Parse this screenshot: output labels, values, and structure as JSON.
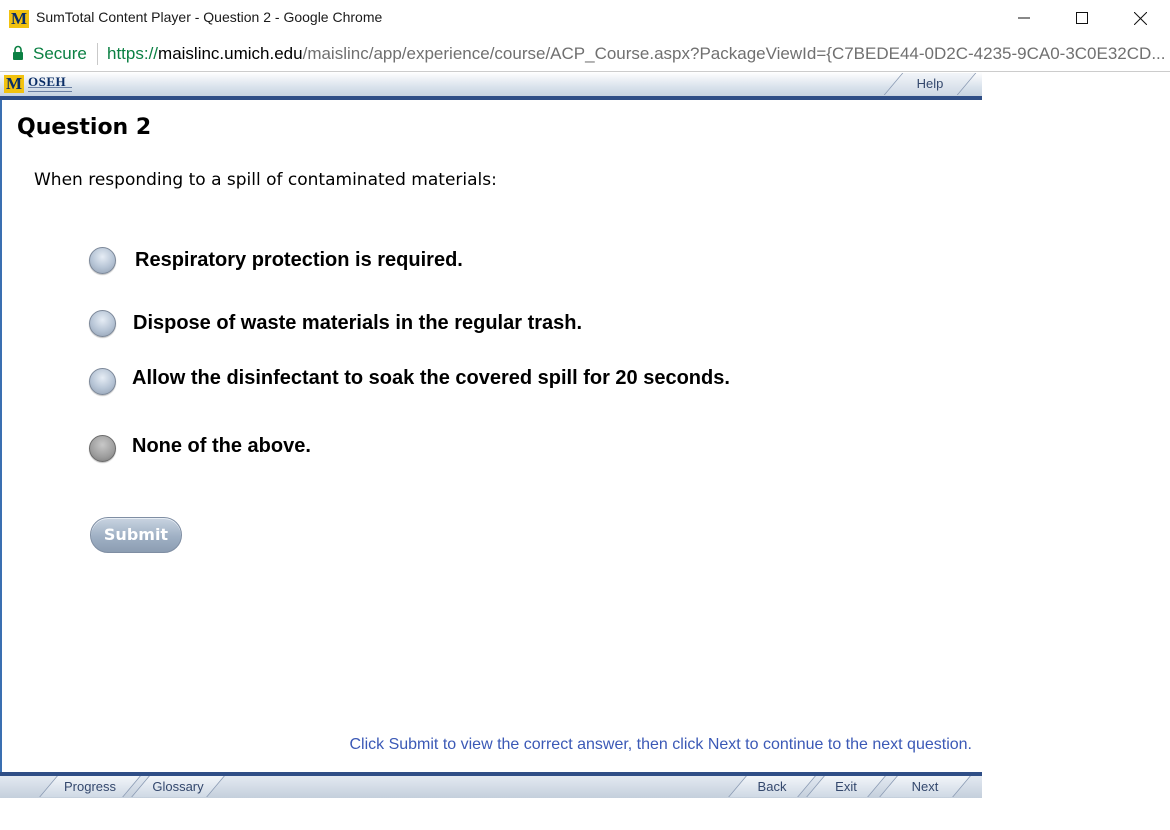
{
  "window": {
    "title": "SumTotal Content Player - Question 2 - Google Chrome",
    "app_logo": "M"
  },
  "addressbar": {
    "secure_label": "Secure",
    "url_scheme": "https://",
    "url_domain": "maislinc.umich.edu",
    "url_path": "/maislinc/app/experience/course/ACP_Course.aspx?PackageViewId={C7BEDE44-0D2C-4235-9CA0-3C0E32CD..."
  },
  "header": {
    "brand_m": "M",
    "brand_text": "OSEH",
    "help_label": "Help"
  },
  "question": {
    "title": "Question 2",
    "prompt": "When responding to a spill of contaminated materials:",
    "options": [
      {
        "label": "Respiratory protection is required.",
        "selected": false
      },
      {
        "label": "Dispose of waste materials in the regular trash.",
        "selected": false
      },
      {
        "label": "Allow the disinfectant to soak the covered spill for 20 seconds.",
        "selected": false
      },
      {
        "label": "None of the above.",
        "selected": false
      }
    ],
    "submit_label": "Submit"
  },
  "instruction": "Click Submit to view the correct answer, then click Next to continue to the next question.",
  "footer": {
    "progress_label": "Progress",
    "glossary_label": "Glossary",
    "back_label": "Back",
    "exit_label": "Exit",
    "next_label": "Next"
  },
  "colors": {
    "accent_navy": "#2f4e86",
    "secure_green": "#0b8043",
    "instruction_blue": "#3b59b6",
    "brand_gold": "#f2c20f"
  }
}
